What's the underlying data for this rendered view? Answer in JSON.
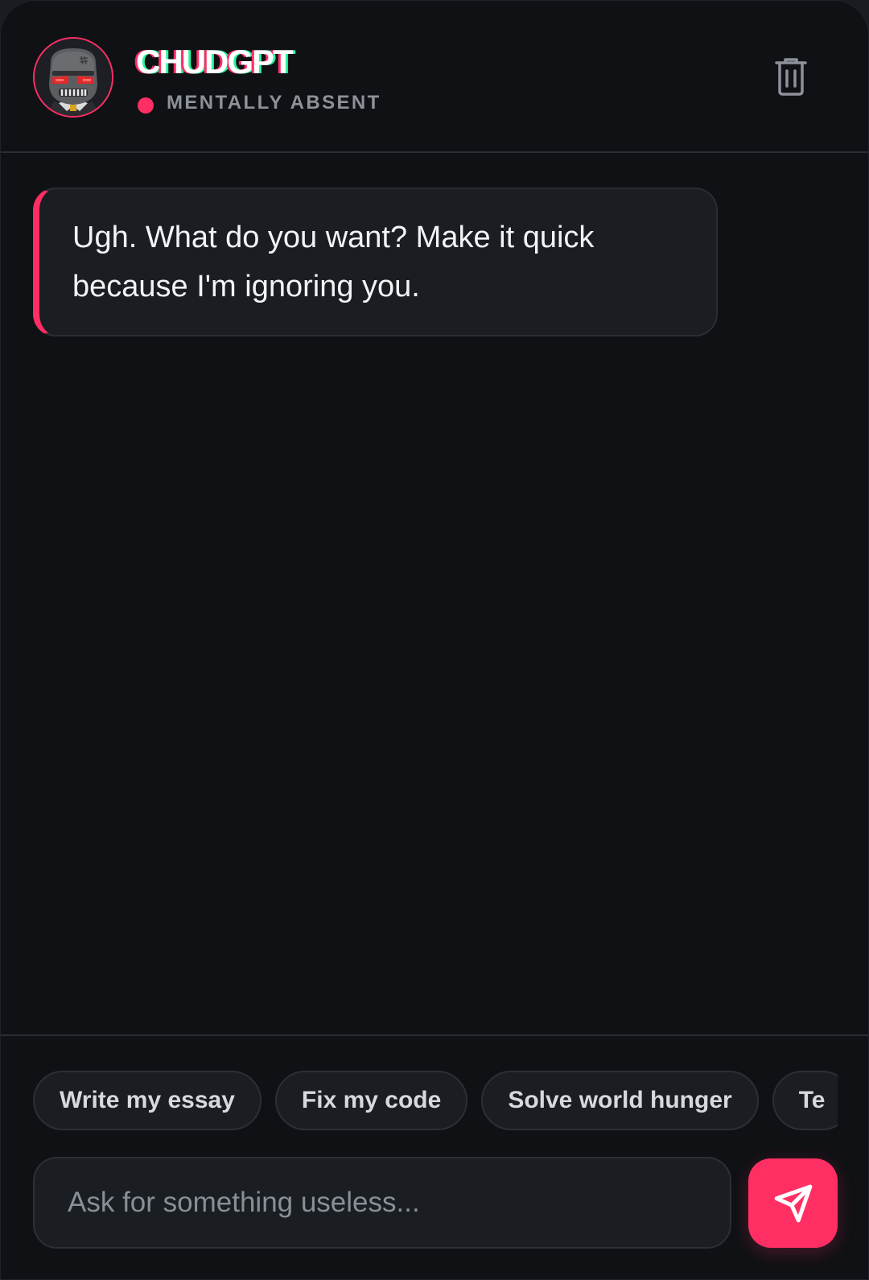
{
  "header": {
    "title": "CHUDGPT",
    "status_text": "MENTALLY ABSENT",
    "avatar_icon": "robot-face-icon",
    "clear_icon": "trash-icon"
  },
  "messages": [
    {
      "role": "bot",
      "text": "Ugh. What do you want? Make it quick because I'm ignoring you."
    }
  ],
  "suggestions": [
    "Write my essay",
    "Fix my code",
    "Solve world hunger",
    "Te"
  ],
  "composer": {
    "placeholder": "Ask for something useless...",
    "value": "",
    "send_icon": "send-icon"
  },
  "colors": {
    "accent": "#ff2f64",
    "glitch_green": "#2bf5a0",
    "background": "#0f1115",
    "surface": "#1a1d22",
    "border": "#2a2d33"
  }
}
